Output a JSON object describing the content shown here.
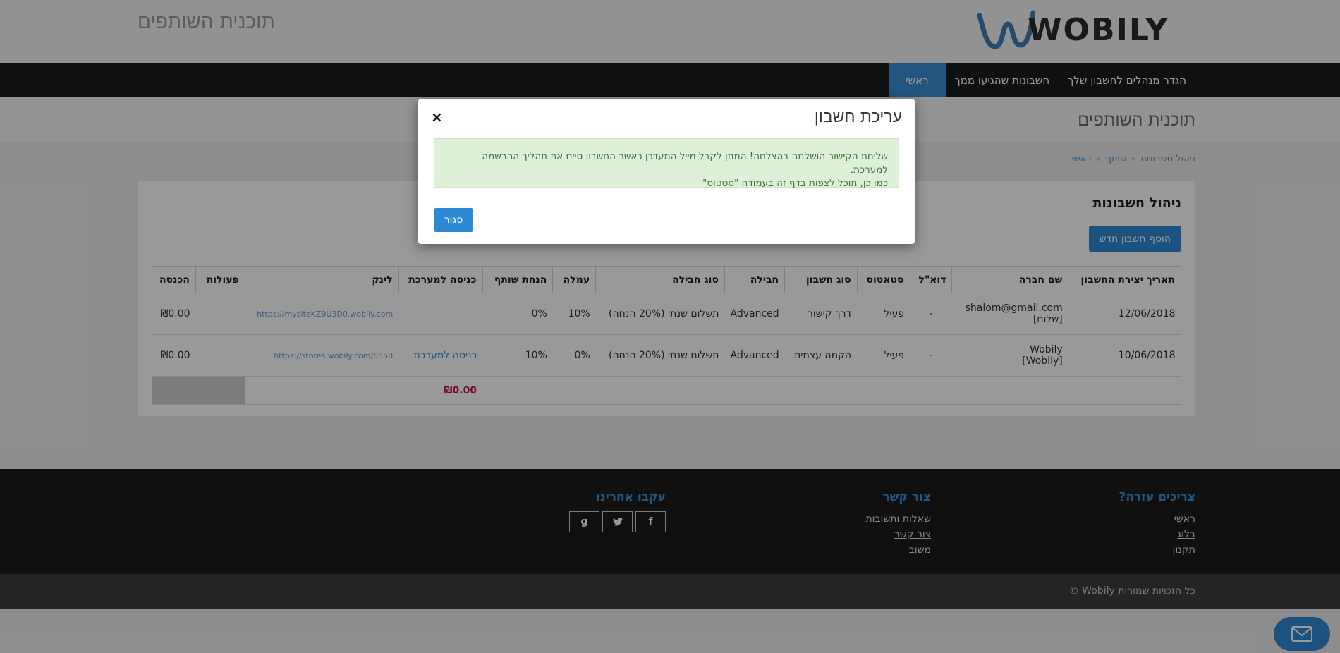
{
  "header": {
    "title": "תוכנית השותפים",
    "logo_text": "WOBILY"
  },
  "nav": {
    "items": [
      {
        "label": "ראשי",
        "active": true
      },
      {
        "label": "חשבונות שהגיעו ממך"
      },
      {
        "label": "הגדר מנהלים לחשבון שלך"
      }
    ]
  },
  "page": {
    "title": "תוכנית השותפים"
  },
  "breadcrumb": {
    "home": "ראשי",
    "partner": "שותף",
    "sep": "»",
    "current": "ניהול חשבונות"
  },
  "card": {
    "title": "ניהול חשבונות",
    "add_button": "הוסף חשבון חדש"
  },
  "table": {
    "headers": [
      "תאריך יצירת החשבון",
      "שם חברה",
      "דוא\"ל",
      "סטאטוס",
      "סוג חשבון",
      "חבילה",
      "סוג חבילה",
      "עמלה",
      "הנחת שותף",
      "כניסה למערכת",
      "לינק",
      "פעולות",
      "הכנסה"
    ],
    "rows": [
      {
        "date": "12/06/2018",
        "company_line1": "shalom@gmail.com",
        "company_line2": "[שלום]",
        "email": "-",
        "status": "פעיל",
        "account_type": "דרך קישור",
        "package": "Advanced",
        "package_type": "תשלום שנתי (20% הנחה)",
        "commission": "10%",
        "discount": "0%",
        "enter": "",
        "link": "https://mysiteKZ9U3D0.wobily.com",
        "income": "₪0.00"
      },
      {
        "date": "10/06/2018",
        "company_line1": "Wobily",
        "company_line2": "[Wobily]",
        "email": "-",
        "status": "פעיל",
        "account_type": "הקמה עצמית",
        "package": "Advanced",
        "package_type": "תשלום שנתי (20% הנחה)",
        "commission": "0%",
        "discount": "10%",
        "enter": "כניסה למערכת",
        "link": "https://stores.wobily.com/6550",
        "income": "₪0.00"
      }
    ],
    "total": "₪0.00"
  },
  "footer": {
    "help": {
      "title": "צריכים עזרה?",
      "links": [
        "ראשי",
        "בלוג",
        "תקנון"
      ]
    },
    "contact": {
      "title": "צור קשר",
      "links": [
        "שאלות ותשובות",
        "צור קשר",
        "משוב"
      ]
    },
    "follow": {
      "title": "עקבו אחרינו",
      "icons": [
        "facebook-icon",
        "twitter-icon",
        "google-plus-icon"
      ]
    },
    "copyright": "כל הזכויות שמורות Wobily ©"
  },
  "modal": {
    "title": "עריכת חשבון",
    "close_icon": "×",
    "alert_line1": "שליחת הקישור הושלמה בהצלחה! המתן לקבל מייל המעדכן כאשר החשבון סיים את תהליך ההרשמה למערכת.",
    "alert_line2": "כמו כן, תוכל לצפות בדף זה בעמודה \"סטטוס\"",
    "close_button": "סגור"
  },
  "colors": {
    "accent": "#2d89d6",
    "nav_bg": "#1c1c1c",
    "alert_bg": "#dff0d8",
    "alert_text": "#3c763d",
    "total": "#c2185b"
  }
}
